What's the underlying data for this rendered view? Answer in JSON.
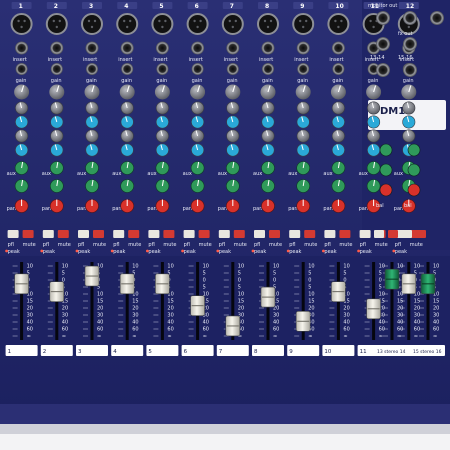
{
  "image": {
    "subject": "mixing-console-close-up",
    "model_label": "DM16"
  },
  "header": {
    "channel_numbers": [
      "1",
      "2",
      "3",
      "4",
      "5",
      "6",
      "7",
      "8",
      "9",
      "10",
      "11",
      "12"
    ],
    "monitor_out_label": "monitor out",
    "fx_out_label": "fx out",
    "stereo_pair_a": "13-14",
    "stereo_pair_b": "15-16"
  },
  "strip_labels": {
    "input": "input",
    "insert": "insert",
    "gain": "gain",
    "aux": "aux",
    "fx": "fx",
    "pan": "pan",
    "bal": "bal",
    "pfl": "pfl",
    "mute": "mute",
    "peak": "peak"
  },
  "fader_scribble": [
    "1",
    "2",
    "3",
    "4",
    "5",
    "6",
    "7",
    "8",
    "9",
    "10",
    "11",
    "12",
    "13 stereo 14",
    "15 stereo 16"
  ],
  "fader_levels": [
    0.72,
    0.62,
    0.82,
    0.72,
    0.72,
    0.44,
    0.18,
    0.55,
    0.24,
    0.62,
    0.4,
    0.72,
    0.78,
    0.72
  ],
  "fader_scale": [
    "10",
    "5",
    "0",
    "5",
    "10",
    "15",
    "20",
    "30",
    "40",
    "60",
    "∞"
  ],
  "colors": {
    "panel": "#23286a",
    "panel_dark": "#151a4a",
    "knob_cap_grey": "#7d7f86",
    "knob_blue": "#2aa9d8",
    "knob_green": "#2f9a5a",
    "knob_red": "#d8312a",
    "mute_red": "#d43a32",
    "fader_cap": "#e9e7df",
    "stereo_fader_cap": "#1f8f5a"
  }
}
